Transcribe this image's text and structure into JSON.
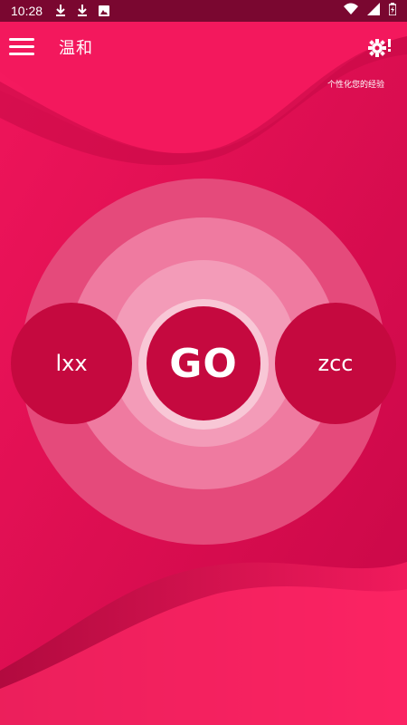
{
  "status_bar": {
    "time": "10:28",
    "notification_icons": [
      "download-icon",
      "download-icon",
      "image-icon"
    ],
    "system_icons": [
      "wifi-icon",
      "signal-icon",
      "battery-icon"
    ]
  },
  "app_bar": {
    "title": "温和",
    "menu_icon": "hamburger-menu-icon",
    "settings_icon": "settings-gear-alert-icon",
    "personalize_label": "个性化您的经验"
  },
  "center": {
    "left_label": "lxx",
    "go_label": "GO",
    "right_label": "zcc"
  },
  "colors": {
    "background": "#d90a4e",
    "status_bar": "#7a0730",
    "button": "#c5093f",
    "ring_outer": "#e54a7b",
    "ring_middle": "#ef7aa0",
    "ring_inner": "#f39bb8",
    "ring_core": "#f8c7d6"
  }
}
